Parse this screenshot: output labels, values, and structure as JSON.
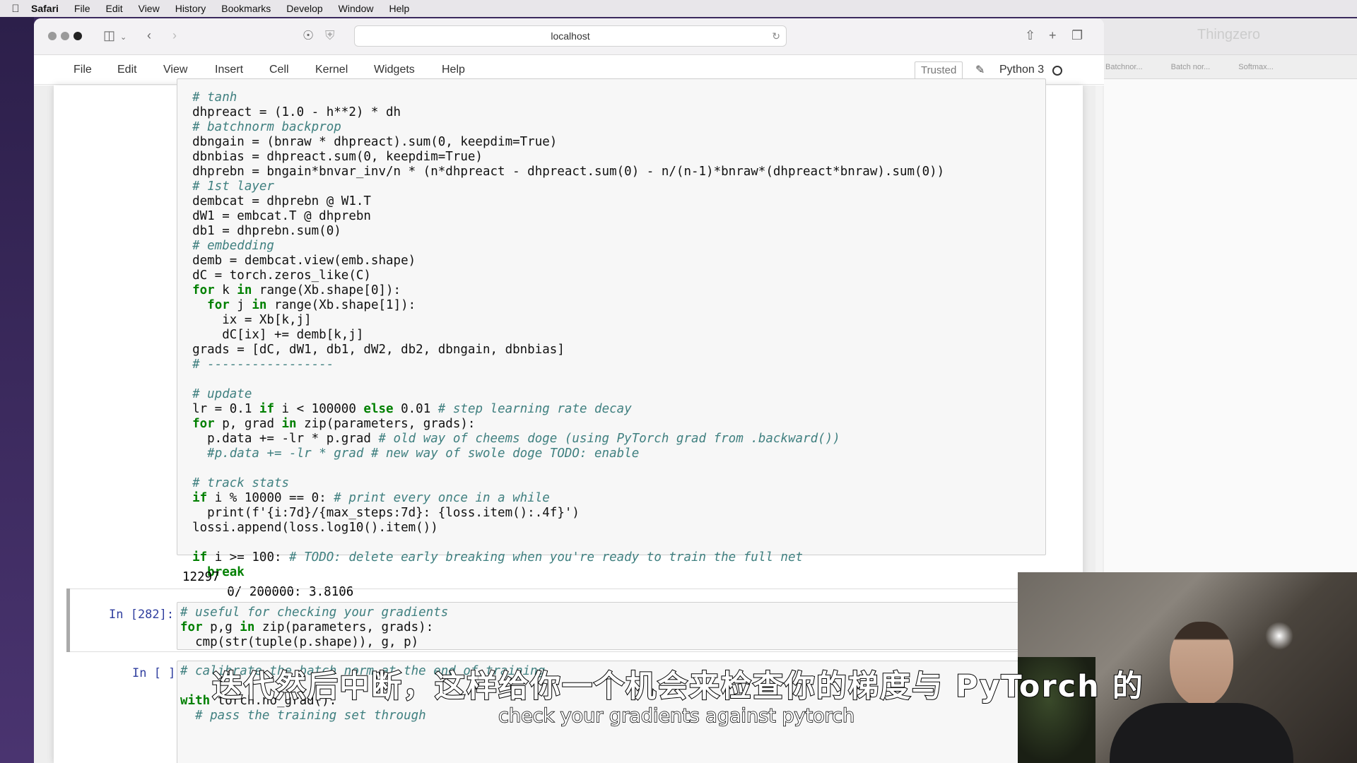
{
  "menubar": {
    "items": [
      "Safari",
      "File",
      "Edit",
      "View",
      "History",
      "Bookmarks",
      "Develop",
      "Window",
      "Help"
    ]
  },
  "browser": {
    "address": "localhost"
  },
  "background_window": {
    "title": "Thingzero",
    "tabs": [
      "Batchnor...",
      "Batch nor...",
      "Softmax..."
    ]
  },
  "jupyter": {
    "menu": [
      "File",
      "Edit",
      "View",
      "Insert",
      "Cell",
      "Kernel",
      "Widgets",
      "Help"
    ],
    "trusted_label": "Trusted",
    "kernel_name": "Python 3"
  },
  "cells": {
    "cell1_lines": [
      "  # tanh",
      "  dhpreact = (1.0 - h**2) * dh",
      "  # batchnorm backprop",
      "  dbngain = (bnraw * dhpreact).sum(0, keepdim=True)",
      "  dbnbias = dhpreact.sum(0, keepdim=True)",
      "  dhprebn = bngain*bnvar_inv/n * (n*dhpreact - dhpreact.sum(0) - n/(n-1)*bnraw*(dhpreact*bnraw).sum(0))",
      "  # 1st layer",
      "  dembcat = dhprebn @ W1.T",
      "  dW1 = embcat.T @ dhprebn",
      "  db1 = dhprebn.sum(0)",
      "  # embedding",
      "  demb = dembcat.view(emb.shape)",
      "  dC = torch.zeros_like(C)",
      "  for k in range(Xb.shape[0]):",
      "    for j in range(Xb.shape[1]):",
      "      ix = Xb[k,j]",
      "      dC[ix] += demb[k,j]",
      "  grads = [dC, dW1, db1, dW2, db2, dbngain, dbnbias]",
      "  # -----------------",
      "",
      "  # update",
      "  lr = 0.1 if i < 100000 else 0.01 # step learning rate decay",
      "  for p, grad in zip(parameters, grads):",
      "    p.data += -lr * p.grad # old way of cheems doge (using PyTorch grad from .backward())",
      "    #p.data += -lr * grad # new way of swole doge TODO: enable",
      "",
      "  # track stats",
      "  if i % 10000 == 0: # print every once in a while",
      "    print(f'{i:7d}/{max_steps:7d}: {loss.item():.4f}')",
      "  lossi.append(loss.log10().item())",
      "",
      "  if i >= 100: # TODO: delete early breaking when you're ready to train the full net",
      "    break"
    ],
    "cell1_output": [
      "12297",
      "      0/ 200000: 3.8106"
    ],
    "cell2_prompt": "In [282]:",
    "cell2_lines": [
      "# useful for checking your gradients",
      "for p,g in zip(parameters, grads):",
      "  cmp(str(tuple(p.shape)), g, p)"
    ],
    "cell3_prompt": "In [ ]:",
    "cell3_lines": [
      "# calibrate the batch norm at the end of training",
      "",
      "with torch.no_grad():",
      "  # pass the training set through"
    ]
  },
  "subtitles": {
    "chinese": "迭代然后中断，这样给你一个机会来检查你的梯度与 PyTorch 的",
    "english": "check your gradients against pytorch"
  },
  "colors": {
    "keyword": "#008000",
    "comment": "#408080",
    "prompt": "#303f9f"
  }
}
